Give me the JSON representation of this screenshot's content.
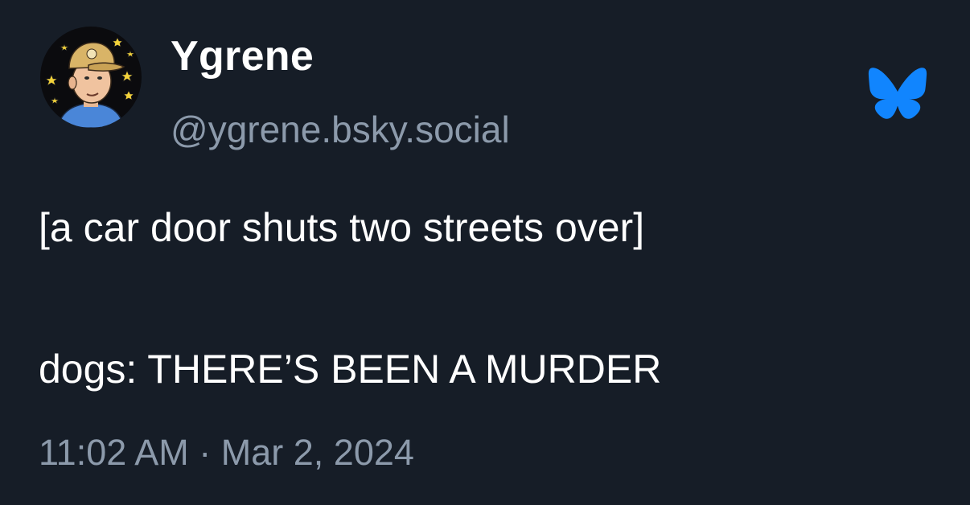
{
  "author": {
    "display_name": "Ygrene",
    "handle": "@ygrene.bsky.social",
    "avatar_icon": "cartoon-man-with-cap-avatar"
  },
  "post": {
    "lines": [
      "[a car door shuts two streets over]",
      "dogs: THERE’S BEEN A MURDER"
    ]
  },
  "timestamp": "11:02 AM · Mar 2, 2024",
  "brand": {
    "logo_icon": "bluesky-butterfly-icon",
    "logo_color": "#1185fe"
  },
  "colors": {
    "background": "#161d27",
    "primary_text": "#ffffff",
    "secondary_text": "#8c9aab"
  }
}
